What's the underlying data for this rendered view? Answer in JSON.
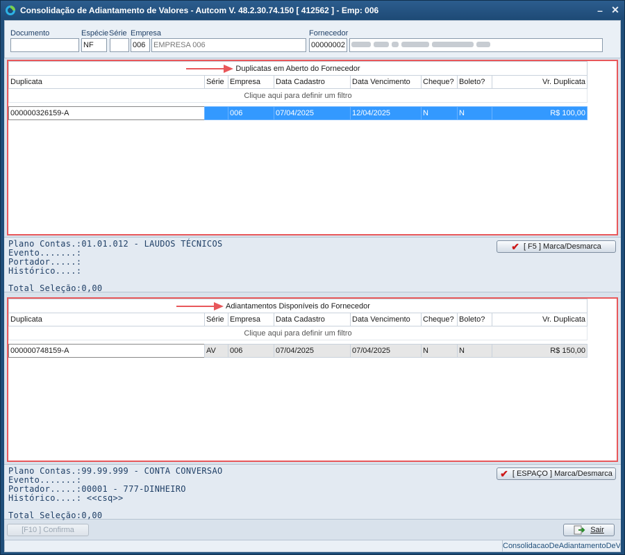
{
  "window": {
    "title": "Consolidação de Adiantamento de Valores   -   Autcom V. 48.2.30.74.150 [ 412562 ] - Emp: 006",
    "minimize": "–",
    "close": "✕"
  },
  "header": {
    "documento_label": "Documento",
    "documento_value": "",
    "especie_label": "Espécie",
    "especie_value": "NF",
    "serie_label": "Série",
    "serie_value": "",
    "empresa_label": "Empresa",
    "empresa_code": "006",
    "empresa_name": "EMPRESA 006",
    "fornecedor_label": "Fornecedor",
    "fornecedor_code": "00000002"
  },
  "grid_columns": [
    "Duplicata",
    "Série",
    "Empresa",
    "Data Cadastro",
    "Data Vencimento",
    "Cheque?",
    "Boleto?",
    "Vr. Duplicata"
  ],
  "filter_text": "Clique aqui para definir um filtro",
  "duplicatas": {
    "title": "Duplicatas em Aberto do Fornecedor",
    "rows": [
      [
        "000000326159-A",
        "",
        "006",
        "07/04/2025",
        "12/04/2025",
        "N",
        "N",
        "R$ 100,00"
      ]
    ]
  },
  "info1": {
    "plano": "Plano Contas.:01.01.012 - LAUDOS TÉCNICOS",
    "evento": "Evento.......:",
    "portador": "Portador.....:",
    "historico": "Histórico....:",
    "total": "Total Seleção:0,00"
  },
  "btn_f5": "[ F5 ] Marca/Desmarca",
  "adiantamentos": {
    "title": "Adiantamentos Disponíveis do Fornecedor",
    "rows": [
      [
        "000000748159-A",
        "AV",
        "006",
        "07/04/2025",
        "07/04/2025",
        "N",
        "N",
        "R$ 150,00"
      ]
    ]
  },
  "info2": {
    "plano": "Plano Contas.:99.99.999 - CONTA CONVERSAO",
    "evento": "Evento.......:",
    "portador": "Portador.....:00001 - 777-DINHEIRO",
    "historico": "Histórico....: <<csq>>",
    "total": "Total Seleção:0,00"
  },
  "btn_espaco": "[ ESPAÇO ] Marca/Desmarca",
  "btn_confirma": "[F10 ] Confirma",
  "btn_sair": "Sair",
  "statusbar": "ConsolidacaoDeAdiantamentoDeValo",
  "colors": {
    "accent": "#1f4e79",
    "selection": "#3399ff",
    "highlight_border": "#e8575a"
  }
}
